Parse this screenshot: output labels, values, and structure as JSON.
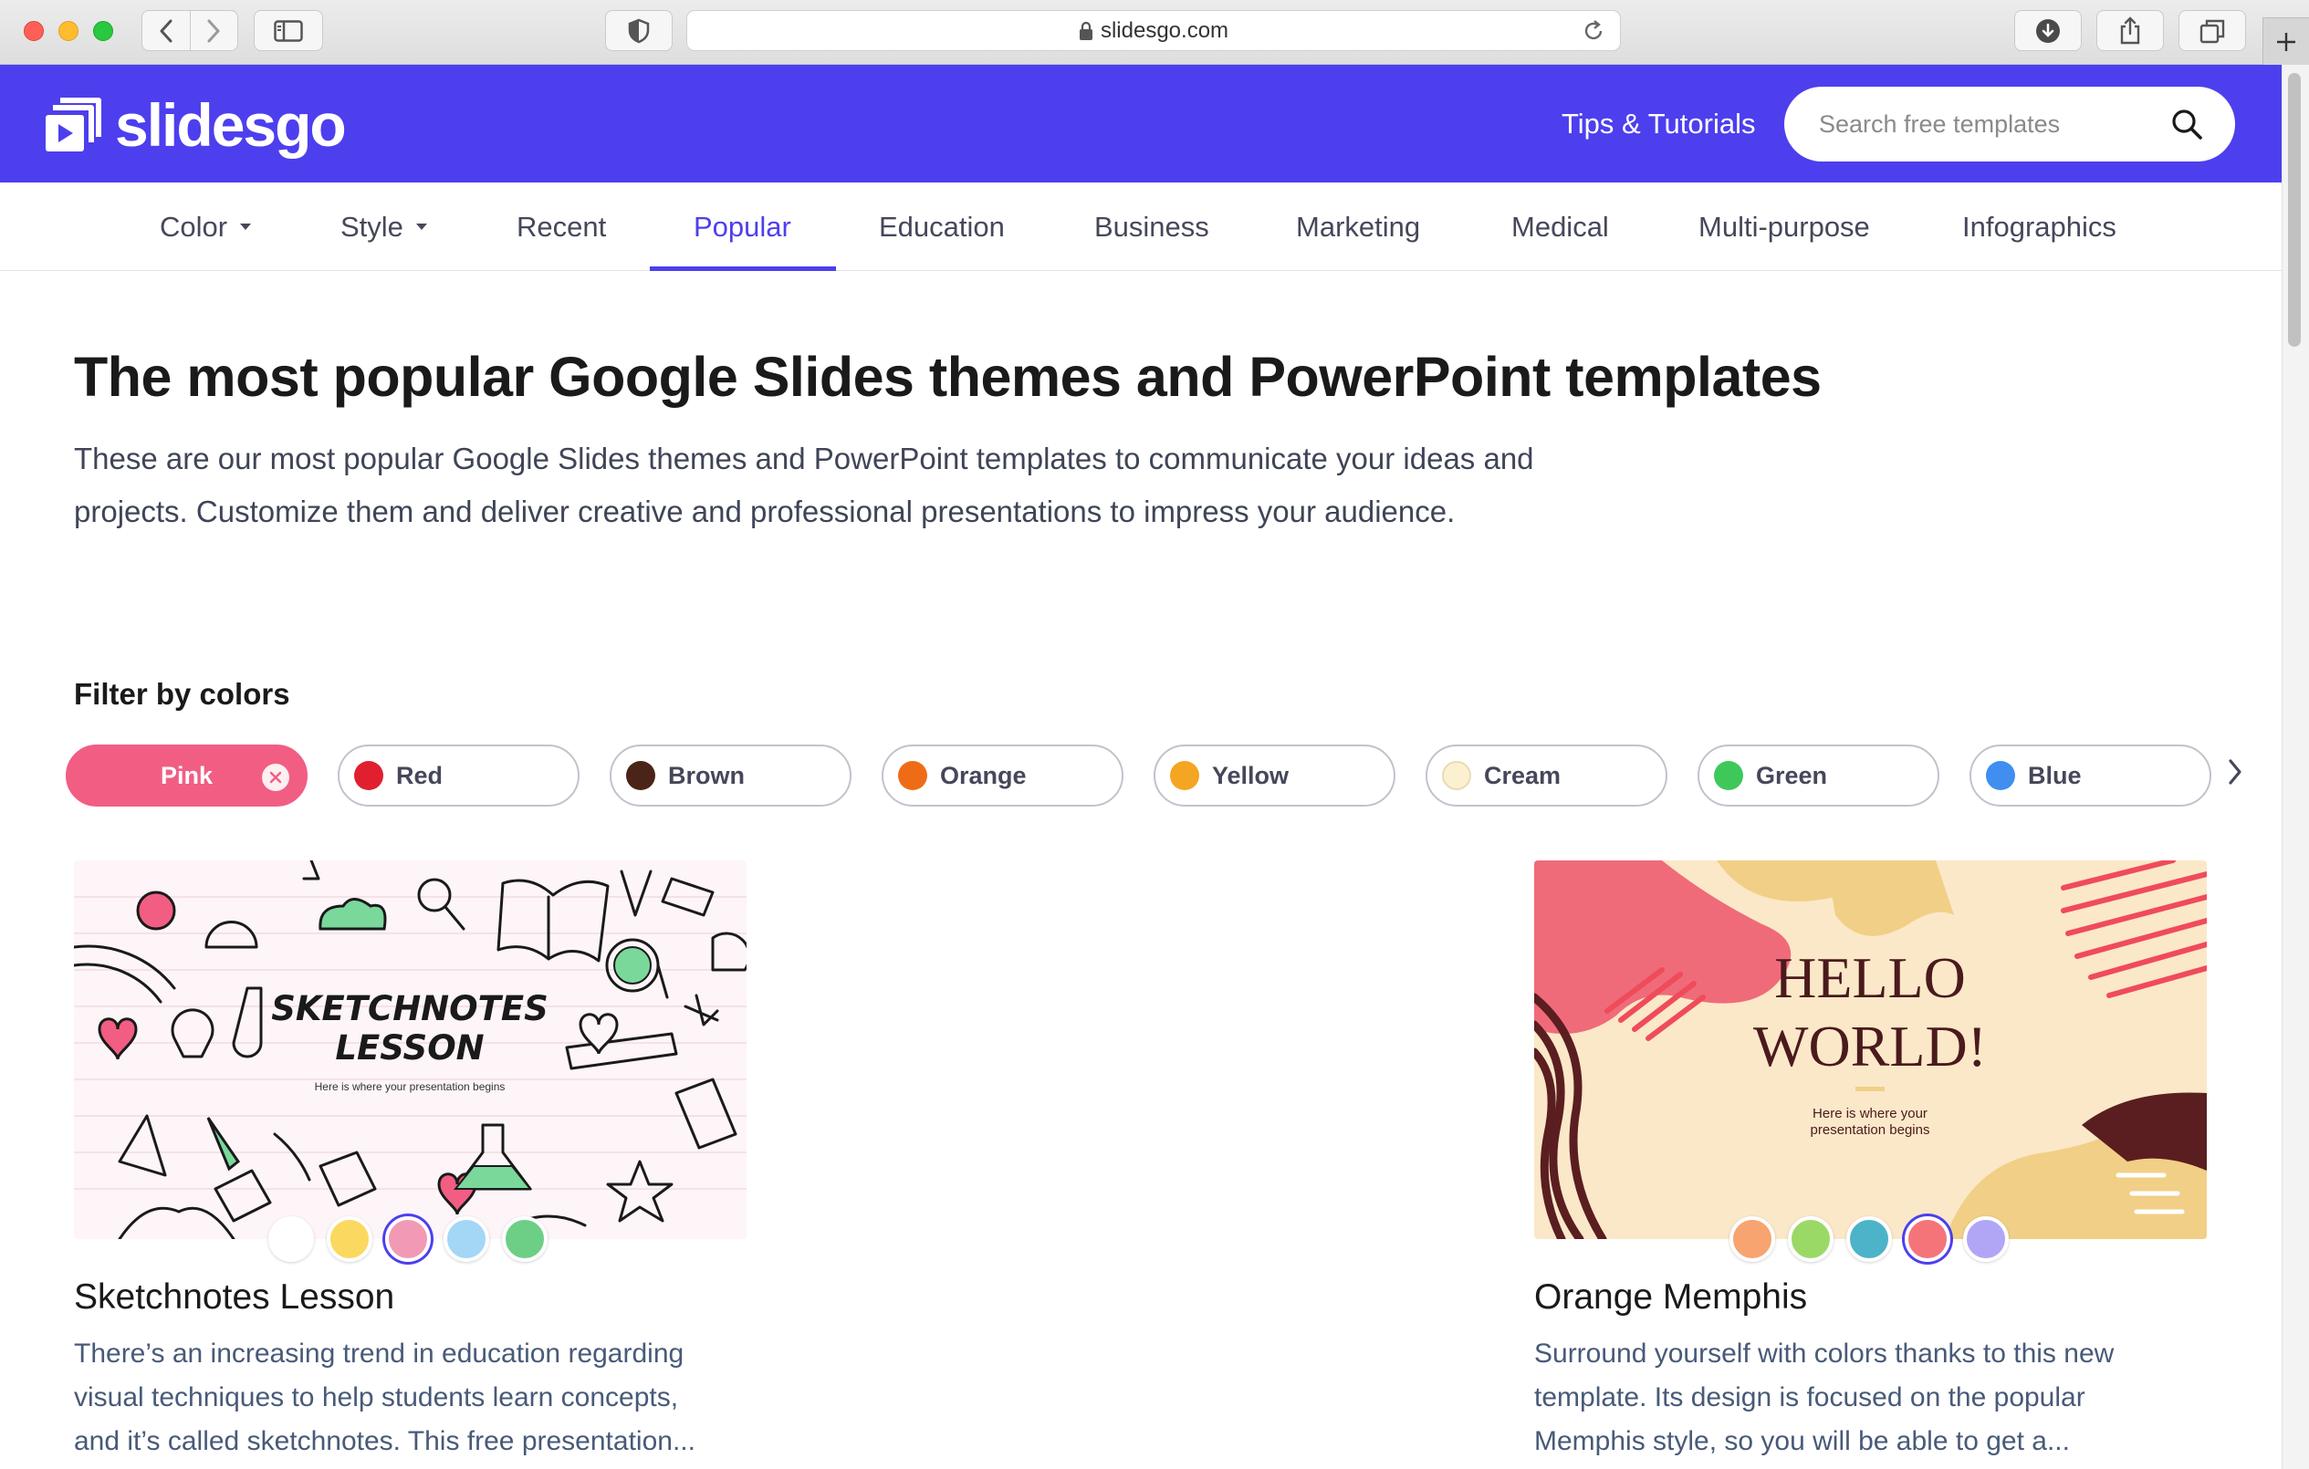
{
  "browser": {
    "url": "slidesgo.com"
  },
  "header": {
    "logo_text": "slidesgo",
    "tips_link": "Tips & Tutorials",
    "search_placeholder": "Search free templates",
    "brand_color": "#4d3fee"
  },
  "nav": {
    "items": [
      {
        "label": "Color",
        "has_dropdown": true
      },
      {
        "label": "Style",
        "has_dropdown": true
      },
      {
        "label": "Recent"
      },
      {
        "label": "Popular",
        "active": true
      },
      {
        "label": "Education"
      },
      {
        "label": "Business"
      },
      {
        "label": "Marketing"
      },
      {
        "label": "Medical"
      },
      {
        "label": "Multi-purpose"
      },
      {
        "label": "Infographics"
      }
    ]
  },
  "main": {
    "title": "The most popular Google Slides themes and PowerPoint templates",
    "intro": "These are our most popular Google Slides themes and PowerPoint templates to communicate your ideas and projects. Customize them and deliver creative and professional presentations to impress your audience."
  },
  "filter": {
    "title": "Filter by colors",
    "chips": [
      {
        "label": "Pink",
        "color": "#f25d84",
        "selected": true
      },
      {
        "label": "Red",
        "color": "#e0202e"
      },
      {
        "label": "Brown",
        "color": "#4a2417"
      },
      {
        "label": "Orange",
        "color": "#ef6c16"
      },
      {
        "label": "Yellow",
        "color": "#f4a521"
      },
      {
        "label": "Cream",
        "color": "#fbf1d1"
      },
      {
        "label": "Green",
        "color": "#3ec85a"
      },
      {
        "label": "Blue",
        "color": "#3f8ef0"
      }
    ]
  },
  "cards": [
    {
      "title": "Sketchnotes Lesson",
      "desc_lines": [
        "There’s an increasing trend in education regarding",
        "visual techniques to help students learn concepts,",
        "and it’s called sketchnotes. This free presentation..."
      ],
      "thumb_title_1": "SKETCHNOTES",
      "thumb_title_2": "LESSON",
      "thumb_subtitle": "Here is where your presentation begins",
      "swatches": [
        "#ffffff",
        "#fbd860",
        "#f29ab5",
        "#a4d6f5",
        "#6dcf86"
      ],
      "selected_swatch": 2
    },
    {
      "title": "Orange Memphis",
      "desc_lines": [
        "Surround yourself with colors thanks to this new",
        "template. Its design is focused on the popular",
        "Memphis style, so you will be able to get a..."
      ],
      "thumb_title_1": "HELLO",
      "thumb_title_2": "WORLD!",
      "thumb_subtitle_1": "Here is where your",
      "thumb_subtitle_2": "presentation begins",
      "swatches": [
        "#f7a470",
        "#9bd967",
        "#4db3c8",
        "#f4747a",
        "#b1a6f6"
      ],
      "selected_swatch": 3
    }
  ]
}
